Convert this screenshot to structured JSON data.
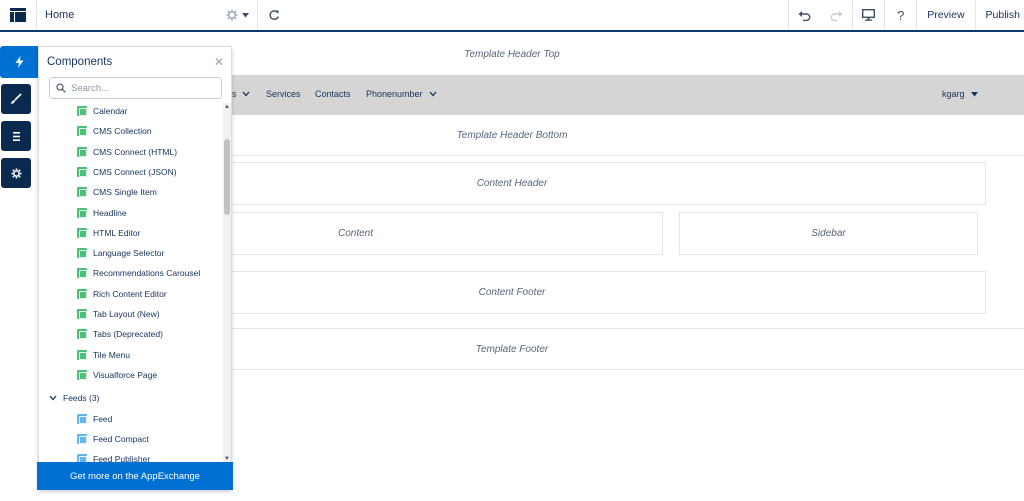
{
  "topbar": {
    "page_name": "Home",
    "preview_label": "Preview",
    "publish_label": "Publish",
    "help_label": "?"
  },
  "panel": {
    "title": "Components",
    "search_placeholder": "Search...",
    "items": [
      {
        "label": "Calendar",
        "color": "#4bc076"
      },
      {
        "label": "CMS Collection",
        "color": "#4bc076"
      },
      {
        "label": "CMS Connect (HTML)",
        "color": "#4bc076"
      },
      {
        "label": "CMS Connect (JSON)",
        "color": "#4bc076"
      },
      {
        "label": "CMS Single Item",
        "color": "#4bc076"
      },
      {
        "label": "Headline",
        "color": "#4bc076"
      },
      {
        "label": "HTML Editor",
        "color": "#4bc076"
      },
      {
        "label": "Language Selector",
        "color": "#4bc076"
      },
      {
        "label": "Recommendations Carousel",
        "color": "#4bc076"
      },
      {
        "label": "Rich Content Editor",
        "color": "#4bc076"
      },
      {
        "label": "Tab Layout (New)",
        "color": "#4bc076"
      },
      {
        "label": "Tabs (Deprecated)",
        "color": "#4bc076"
      },
      {
        "label": "Tile Menu",
        "color": "#4bc076"
      },
      {
        "label": "Visualforce Page",
        "color": "#4bc076"
      }
    ],
    "group": {
      "label": "Feeds (3)"
    },
    "feed_items": [
      {
        "label": "Feed",
        "color": "#62b7ed"
      },
      {
        "label": "Feed Compact",
        "color": "#62b7ed"
      },
      {
        "label": "Feed Publisher",
        "color": "#62b7ed"
      }
    ],
    "appexchange_label": "Get more on the AppExchange"
  },
  "canvas": {
    "header_top": "Template Header Top",
    "nav_items": [
      "s",
      "Services",
      "Contacts",
      "Phonenumber"
    ],
    "user_menu": "kgarg",
    "header_bottom": "Template Header Bottom",
    "content_header": "Content Header",
    "content": "Content",
    "sidebar": "Sidebar",
    "content_footer": "Content Footer",
    "template_footer": "Template Footer"
  },
  "colors": {
    "accent": "#0070d2",
    "rail_dark": "#0b2a4f",
    "nav_band": "#d5d5d5"
  }
}
